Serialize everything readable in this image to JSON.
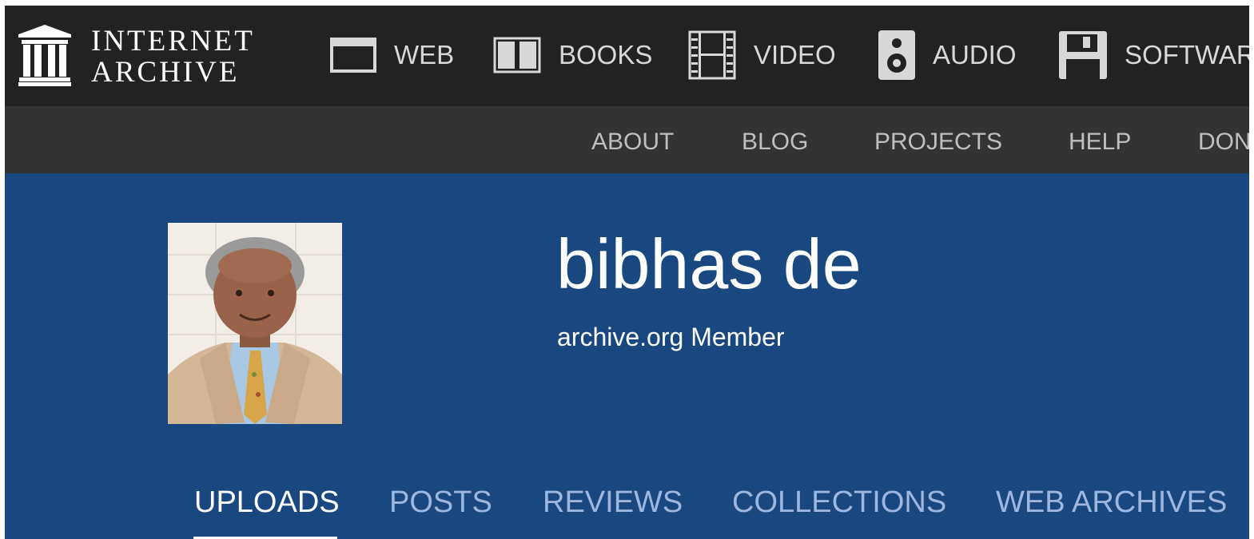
{
  "logo": {
    "line1": "INTERNET",
    "line2": "ARCHIVE"
  },
  "media_nav": [
    {
      "label": "WEB",
      "icon": "web-window-icon"
    },
    {
      "label": "BOOKS",
      "icon": "open-book-icon"
    },
    {
      "label": "VIDEO",
      "icon": "film-strip-icon"
    },
    {
      "label": "AUDIO",
      "icon": "speaker-icon"
    },
    {
      "label": "SOFTWAR",
      "icon": "floppy-disk-icon"
    }
  ],
  "sub_nav": [
    "ABOUT",
    "BLOG",
    "PROJECTS",
    "HELP",
    "DON"
  ],
  "profile": {
    "name": "bibhas de",
    "subtitle": "archive.org Member"
  },
  "tabs": [
    {
      "label": "UPLOADS",
      "active": true
    },
    {
      "label": "POSTS",
      "active": false
    },
    {
      "label": "REVIEWS",
      "active": false
    },
    {
      "label": "COLLECTIONS",
      "active": false
    },
    {
      "label": "WEB ARCHIVES",
      "active": false
    }
  ],
  "colors": {
    "top_nav_bg": "#222222",
    "sub_nav_bg": "#333333",
    "banner_bg": "#194880",
    "tab_inactive": "#9fb7df",
    "tab_active": "#ffffff"
  }
}
